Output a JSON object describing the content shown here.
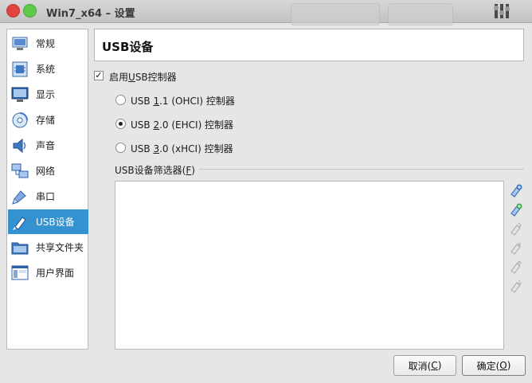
{
  "window": {
    "title": "Win7_x64 – 设置"
  },
  "sidebar": {
    "items": [
      {
        "label": "常规",
        "icon": "general-icon"
      },
      {
        "label": "系统",
        "icon": "system-icon"
      },
      {
        "label": "显示",
        "icon": "display-icon"
      },
      {
        "label": "存储",
        "icon": "storage-icon"
      },
      {
        "label": "声音",
        "icon": "audio-icon"
      },
      {
        "label": "网络",
        "icon": "network-icon"
      },
      {
        "label": "串口",
        "icon": "serial-port-icon"
      },
      {
        "label": "USB设备",
        "icon": "usb-icon",
        "selected": true
      },
      {
        "label": "共享文件夹",
        "icon": "shared-folder-icon"
      },
      {
        "label": "用户界面",
        "icon": "user-interface-icon"
      }
    ]
  },
  "main": {
    "header": "USB设备",
    "enable_usb": {
      "label_pre": "启用",
      "label_u": "U",
      "label_post": "SB控制器",
      "checked": true
    },
    "controllers": [
      {
        "pre": "USB ",
        "u": "1",
        "post": ".1 (OHCI) 控制器",
        "checked": false
      },
      {
        "pre": "USB ",
        "u": "2",
        "post": ".0 (EHCI) 控制器",
        "checked": true
      },
      {
        "pre": "USB ",
        "u": "3",
        "post": ".0 (xHCI) 控制器",
        "checked": false
      }
    ],
    "filters_label_pre": "USB设备筛选器(",
    "filters_label_u": "F",
    "filters_label_post": ")",
    "filter_tools": [
      "add-empty-filter-icon",
      "add-filter-from-device-icon",
      "edit-filter-icon",
      "remove-filter-icon",
      "move-filter-up-icon",
      "move-filter-down-icon"
    ]
  },
  "buttons": {
    "cancel_pre": "取消(",
    "cancel_u": "C",
    "cancel_post": ")",
    "ok_pre": "确定(",
    "ok_u": "O",
    "ok_post": ")"
  }
}
